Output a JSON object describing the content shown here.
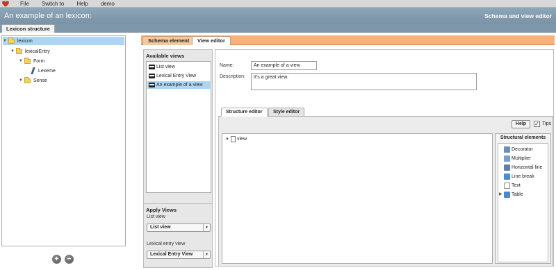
{
  "menu": [
    "File",
    "Switch to",
    "Help",
    "demo"
  ],
  "header": {
    "title": "An example of an lexicon:",
    "subtitle": "Schema and view editor"
  },
  "left_tab": "Lexicon structure",
  "tree": [
    {
      "label": "lexicon",
      "icon": "folder-icon",
      "selected": true
    },
    {
      "label": "lexicalEntry",
      "icon": "folder-icon"
    },
    {
      "label": "Form",
      "icon": "folder-icon"
    },
    {
      "label": "Lexeme",
      "icon": "lexeme-icon"
    },
    {
      "label": "Sense",
      "icon": "folder-icon"
    }
  ],
  "tabs": {
    "schema_element": "Schema element",
    "view_editor": "View editor"
  },
  "available_views": {
    "title": "Available views",
    "items": [
      "List view",
      "Lexical Entry View",
      "An example of a view"
    ],
    "selected_index": 2
  },
  "apply_views": {
    "title": "Apply Views",
    "list_view_label": "List view",
    "list_view_value": "List view",
    "lexical_entry_label": "Lexical entry view",
    "lexical_entry_value": "Lexical Entry View"
  },
  "editor": {
    "name_label": "Name:",
    "name_value": "An example of a view",
    "description_label": "Description:",
    "description_value": "It's a great view.",
    "structure_tab": "Structure editor",
    "style_tab": "Style editor",
    "help_label": "Help",
    "tips_label": "Tips",
    "tips_checked": true,
    "root_node": "view"
  },
  "structural_elements": {
    "title": "Structural elements",
    "items": [
      {
        "label": "Decorator",
        "icon": "decorator-icon",
        "color": "#6b8fb5"
      },
      {
        "label": "Multiplier",
        "icon": "multiplier-icon",
        "color": "#7aa0c8"
      },
      {
        "label": "Horizontal line",
        "icon": "horizontal-line-icon",
        "color": "#5f7fa3"
      },
      {
        "label": "Line break",
        "icon": "line-break-icon",
        "color": "#4c8ad1"
      },
      {
        "label": "Text",
        "icon": "text-icon",
        "color": "#dddddd"
      },
      {
        "label": "Table",
        "icon": "table-icon",
        "color": "#4d86c9"
      }
    ]
  }
}
